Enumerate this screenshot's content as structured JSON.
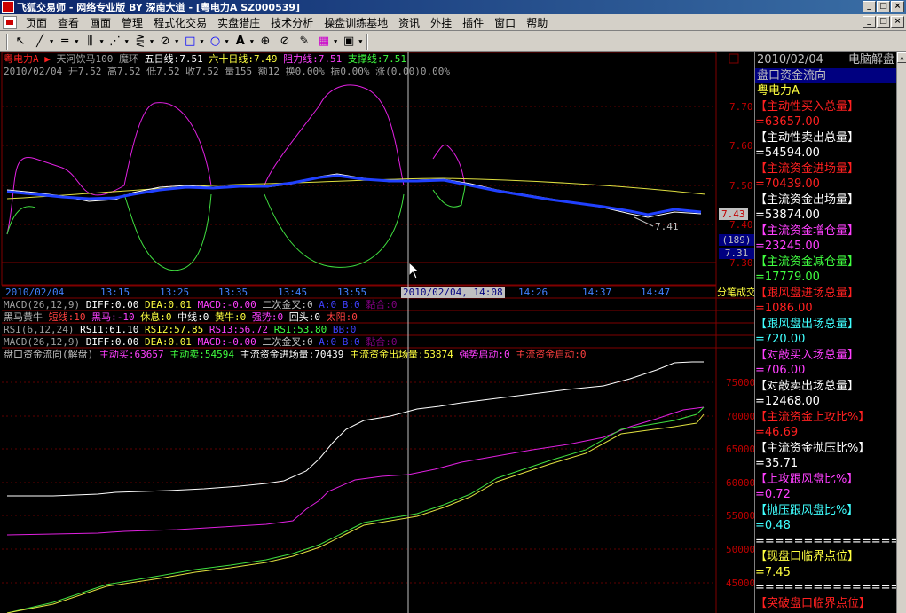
{
  "window": {
    "title": "飞狐交易师 - 网络专业版 BY 深南大道 - [粤电力A  SZ000539]",
    "btn_min": "_",
    "btn_max": "□",
    "btn_close": "×"
  },
  "menu": {
    "items": [
      "页面",
      "查看",
      "画面",
      "管理",
      "程式化交易",
      "实盘猎庄",
      "技术分析",
      "操盘训练基地",
      "资讯",
      "外挂",
      "插件",
      "窗口",
      "帮助"
    ]
  },
  "toolbar": {
    "tools": [
      "↖",
      "╱",
      "═",
      "⫼",
      "⋰",
      "⋛",
      "⊘",
      "□",
      "○",
      "A",
      "⊕",
      "⊘",
      "✎",
      "▦",
      "▣"
    ]
  },
  "price_panel": {
    "line1": {
      "name": "粤电力A",
      "indicator": "天河饮马100",
      "indicator2": "魔环",
      "ma5": "五日线:7.51",
      "ma60": "六十日线:7.49",
      "resistance": "阻力线:7.51",
      "support": "支撑线:7.51"
    },
    "line2": "2010/02/04 开7.52 高7.52 低7.52 收7.52 量155 额12 换0.00% 振0.00% 涨(0.00)0.00%",
    "y_labels": [
      "7.70",
      "7.60",
      "7.50",
      "7.40",
      "7.30"
    ],
    "price_tag": "7.43",
    "box_top": "(189)",
    "box_bottom": "7.31",
    "low_label": "7.41"
  },
  "time_axis": {
    "labels": [
      "2010/02/04",
      "13:15",
      "13:25",
      "13:35",
      "13:45",
      "13:55",
      "2010/02/04, 14:08",
      "14:16",
      "14:26",
      "14:37",
      "14:47"
    ],
    "cursor_label": "2010/02/04, 14:08",
    "right_label": "分笔成交"
  },
  "indicators": {
    "macd1": [
      "MACD(26,12,9)",
      "DIFF:0.00",
      "DEA:0.01",
      "MACD:-0.00",
      "二次金叉:0",
      "A:0",
      "B:0",
      "黏合:0"
    ],
    "hmhn": [
      "黑马黄牛",
      "短线:10",
      "黑马:-10",
      "休息:0",
      "中线:0",
      "黄牛:0",
      "强势:0",
      "回头:0",
      "太阳:0"
    ],
    "rsi": [
      "RSI(6,12,24)",
      "RSI1:61.10",
      "RSI2:57.85",
      "RSI3:56.72",
      "RSI:53.80",
      "BB:0"
    ],
    "macd2": [
      "MACD(26,12,9)",
      "DIFF:0.00",
      "DEA:0.01",
      "MACD:-0.00",
      "二次金叉:0",
      "A:0",
      "B:0",
      "黏合:0"
    ],
    "flow": [
      "盘口资金流向(解盘)",
      "主动买:63657",
      "主动卖:54594",
      "主流资金进场量:70439",
      "主流资金出场量:53874",
      "强势启动:0",
      "主流资金启动:0"
    ],
    "flow_y": [
      "75000",
      "70000",
      "65000",
      "60000",
      "55000",
      "50000",
      "45000"
    ]
  },
  "side_panel": {
    "date": "2010/02/04",
    "caption": "电脑解盘",
    "title": "盘口资金流向",
    "stock": "粤电力A",
    "rows": [
      {
        "label": "【主动性买入总量】",
        "value": "=63657.00",
        "color": "#ff2020"
      },
      {
        "label": "【主动性卖出总量】",
        "value": "=54594.00",
        "color": "#ffffff"
      },
      {
        "label": "【主流资金进场量】",
        "value": "=70439.00",
        "color": "#ff2020"
      },
      {
        "label": "【主流资金出场量】",
        "value": "=53874.00",
        "color": "#ffffff"
      },
      {
        "label": "【主流资金增仓量】",
        "value": "=23245.00",
        "color": "#ff40ff"
      },
      {
        "label": "【主流资金减仓量】",
        "value": "=17779.00",
        "color": "#40ff40"
      },
      {
        "label": "【跟风盘进场总量】",
        "value": "=1086.00",
        "color": "#ff2020"
      },
      {
        "label": "【跟风盘出场总量】",
        "value": "=720.00",
        "color": "#40ffff"
      },
      {
        "label": "【对敲买入场总量】",
        "value": "=706.00",
        "color": "#ff40ff"
      },
      {
        "label": "【对敲卖出场总量】",
        "value": "=12468.00",
        "color": "#ffffff"
      },
      {
        "label": "【主流资金上攻比%】",
        "value": "=46.69",
        "color": "#ff2020"
      },
      {
        "label": "【主流资金抛压比%】",
        "value": "=35.71",
        "color": "#ffffff"
      },
      {
        "label": "【上攻跟风盘比%】",
        "value": "=0.72",
        "color": "#ff40ff"
      },
      {
        "label": "【抛压跟风盘比%】",
        "value": "=0.48",
        "color": "#40ffff"
      }
    ],
    "separator": "================",
    "row_now_label": "【现盘口临界点位】",
    "row_now_value": "=7.45",
    "row_break_label": "【突破盘口临界点位】"
  }
}
